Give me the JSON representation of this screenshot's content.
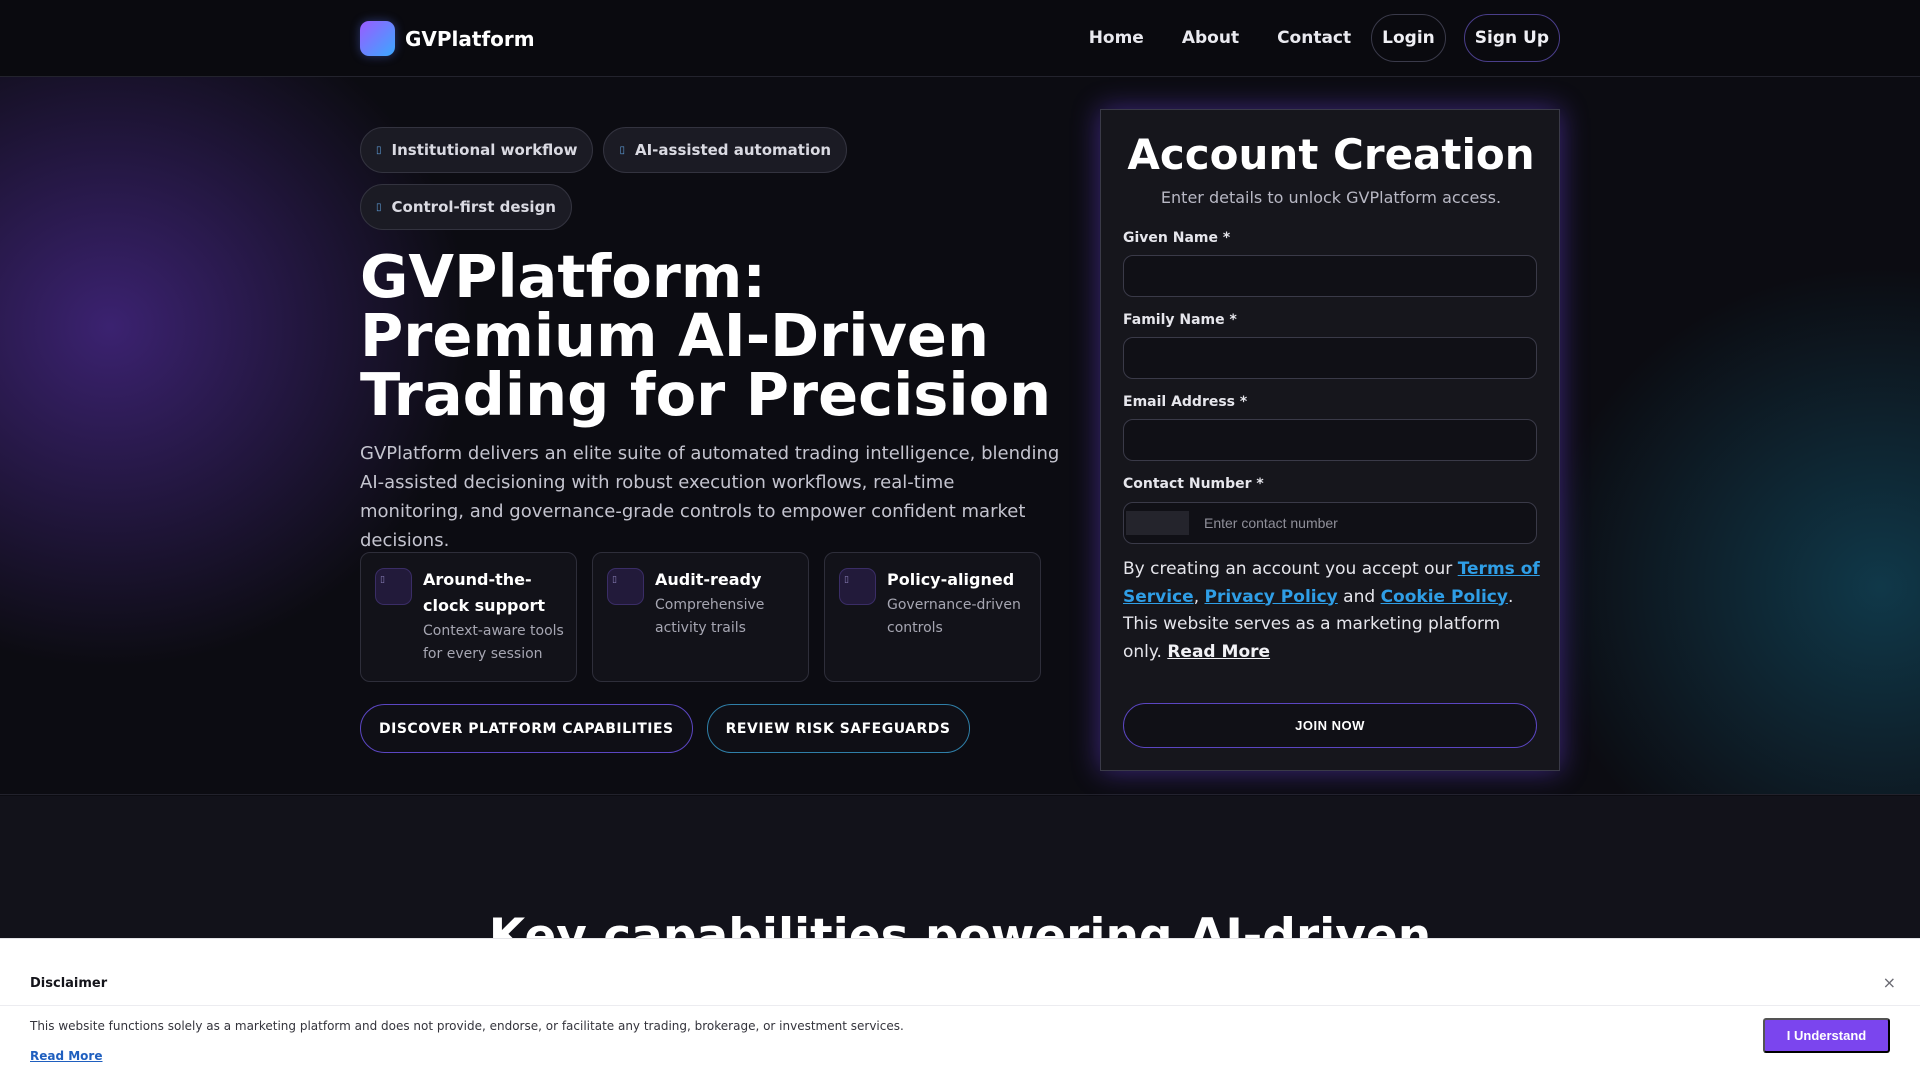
{
  "nav": {
    "brand": "GVPlatform",
    "links": [
      "Home",
      "About",
      "Contact"
    ],
    "login": "Login",
    "signup": "Sign Up"
  },
  "hero": {
    "chips": [
      "Institutional workflow",
      "AI-assisted automation",
      "Control-first design"
    ],
    "title": "GVPlatform: Premium AI-Driven Trading for Precision",
    "description": "GVPlatform delivers an elite suite of automated trading intelligence, blending AI-assisted decisioning with robust execution workflows, real-time monitoring, and governance-grade controls to empower confident market decisions.",
    "features": [
      {
        "title": "Around-the-clock support",
        "desc": "Context-aware tools for every session"
      },
      {
        "title": "Audit-ready",
        "desc": "Comprehensive activity trails"
      },
      {
        "title": "Policy-aligned",
        "desc": "Governance-driven controls"
      }
    ],
    "cta_primary": "DISCOVER PLATFORM CAPABILITIES",
    "cta_secondary": "REVIEW RISK SAFEGUARDS"
  },
  "form": {
    "title": "Account Creation",
    "subtitle": "Enter details to unlock GVPlatform access.",
    "given_name_label": "Given Name *",
    "family_name_label": "Family Name *",
    "email_label": "Email Address *",
    "contact_label": "Contact Number *",
    "contact_placeholder": "Enter contact number",
    "terms_prefix": "By creating an account you accept our ",
    "terms_link": "Terms of Service",
    "comma": ", ",
    "privacy_link": "Privacy Policy",
    "and": " and ",
    "cookie_link": "Cookie Policy",
    "terms_suffix": ". This website serves as a marketing platform only. ",
    "read_more": "Read More",
    "submit": "JOIN NOW"
  },
  "section2": {
    "title": "Key capabilities powering AI-driven"
  },
  "disclaimer": {
    "title": "Disclaimer",
    "close": "×",
    "text": "This website functions solely as a marketing platform and does not provide, endorse, or facilitate any trading, brokerage, or investment services.",
    "read_more": "Read More",
    "button": "I Understand"
  },
  "colors": {
    "accent_purple": "#7b45ee",
    "link_blue": "#2f9ee6",
    "background": "#0c0c12"
  }
}
